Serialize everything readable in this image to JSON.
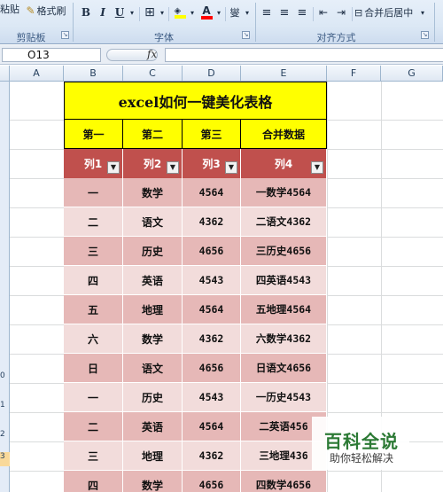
{
  "ribbon": {
    "paste_label": "粘贴",
    "format_painter_label": "格式刷",
    "clipboard_group": "剪贴板",
    "font_group": "字体",
    "align_group": "对齐方式",
    "bold": "B",
    "italic": "I",
    "underline": "U",
    "font_color_glyph": "A",
    "phonetic_glyph": "燮",
    "merge_center_label": "合并后居中"
  },
  "formula_bar": {
    "name_box": "O13",
    "fx_label": "fx",
    "formula_value": ""
  },
  "columns": [
    "A",
    "B",
    "C",
    "D",
    "E",
    "F",
    "G"
  ],
  "row_numbers": [
    "",
    "",
    "",
    "",
    "",
    "",
    "",
    "",
    "",
    "",
    "0",
    "1",
    "2",
    "3",
    ""
  ],
  "table": {
    "title": "excel如何一键美化表格",
    "headers": [
      "第一",
      "第二",
      "第三",
      "合并数据"
    ],
    "filter_headers": [
      "列1",
      "列2",
      "列3",
      "列4"
    ],
    "rows": [
      [
        "一",
        "数学",
        "4564",
        "一数学4564"
      ],
      [
        "二",
        "语文",
        "4362",
        "二语文4362"
      ],
      [
        "三",
        "历史",
        "4656",
        "三历史4656"
      ],
      [
        "四",
        "英语",
        "4543",
        "四英语4543"
      ],
      [
        "五",
        "地理",
        "4564",
        "五地理4564"
      ],
      [
        "六",
        "数学",
        "4362",
        "六数学4362"
      ],
      [
        "日",
        "语文",
        "4656",
        "日语文4656"
      ],
      [
        "一",
        "历史",
        "4543",
        "一历史4543"
      ],
      [
        "二",
        "英语",
        "4564",
        "二英语456"
      ],
      [
        "三",
        "地理",
        "4362",
        "三地理436"
      ],
      [
        "四",
        "数学",
        "4656",
        "四数学4656"
      ]
    ]
  },
  "colors": {
    "title_fill": "#ffff00",
    "filter_header_fill": "#c0504d",
    "band_dark": "#e6b8b7",
    "band_light": "#f2dcdb",
    "watermark_green": "#2c7a35"
  },
  "watermark": {
    "main": "百科全说",
    "sub": "助你轻松解决"
  }
}
